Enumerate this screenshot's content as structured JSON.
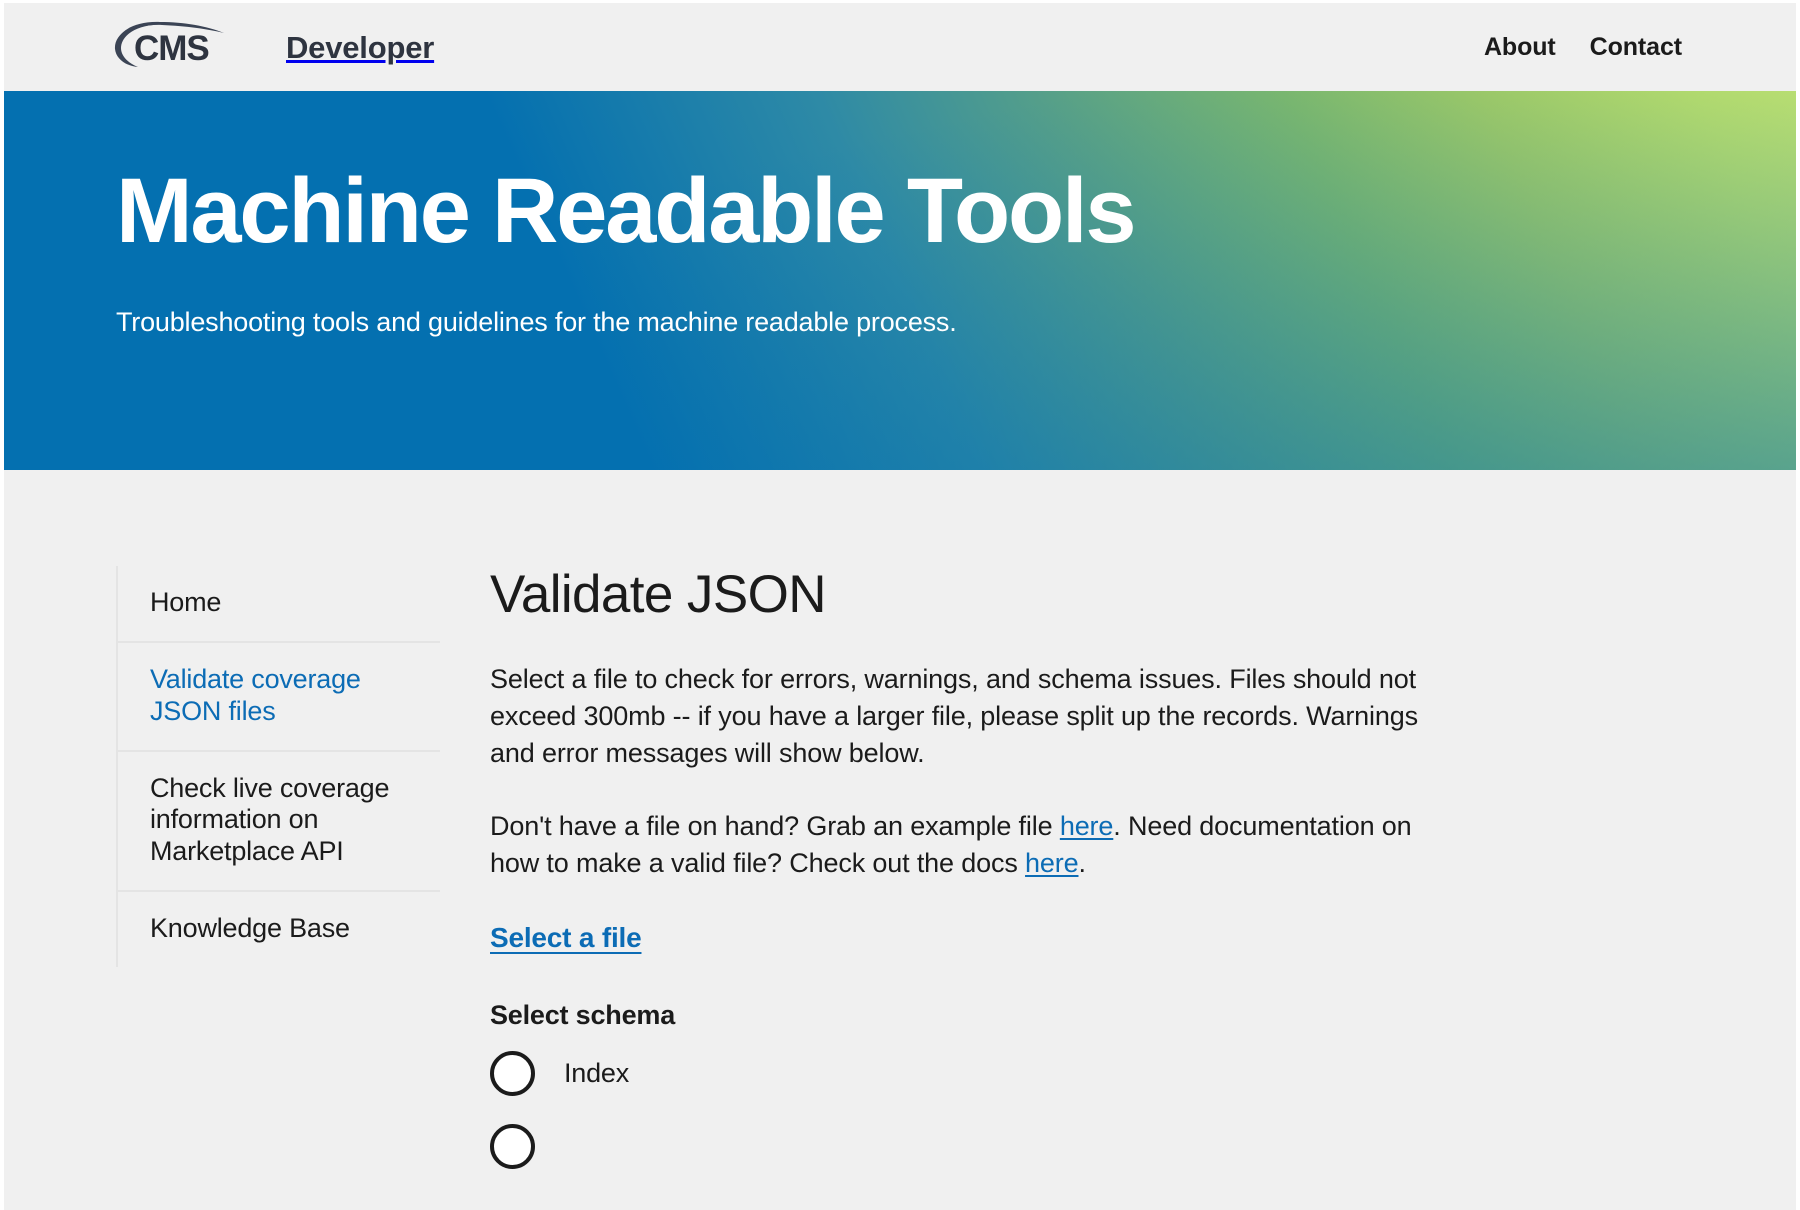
{
  "header": {
    "logo_text": "CMS",
    "logo_icon": "cms-swoosh-logo",
    "brand_word": "Developer",
    "nav": [
      {
        "label": "About"
      },
      {
        "label": "Contact"
      }
    ]
  },
  "hero": {
    "title": "Machine Readable Tools",
    "subtitle": "Troubleshooting tools and guidelines for the machine readable process.",
    "gradient_start": "#0470b0",
    "gradient_end": "#d9f266"
  },
  "sidebar": {
    "items": [
      {
        "label": "Home",
        "active": false
      },
      {
        "label": "Validate coverage JSON files",
        "active": true
      },
      {
        "label": "Check live coverage information on Marketplace API",
        "active": false
      },
      {
        "label": "Knowledge Base",
        "active": false
      }
    ]
  },
  "main": {
    "title": "Validate JSON",
    "paragraph1": "Select a file to check for errors, warnings, and schema issues. Files should not exceed 300mb -- if you have a larger file, please split up the records. Warnings and error messages will show below.",
    "paragraph2": {
      "part1": "Don't have a file on hand? Grab an example file ",
      "link1": "here",
      "part2": ". Need documentation on how to make a valid file? Check out the docs ",
      "link2": "here",
      "part3": "."
    },
    "select_file_label": "Select a file",
    "schema_label": "Select schema",
    "schema_options": [
      {
        "label": "Index",
        "selected": false
      },
      {
        "label": "",
        "selected": false
      }
    ]
  },
  "colors": {
    "link": "#0c6cb5",
    "text": "#1b1b1b",
    "page_bg": "#f0f0f0"
  }
}
